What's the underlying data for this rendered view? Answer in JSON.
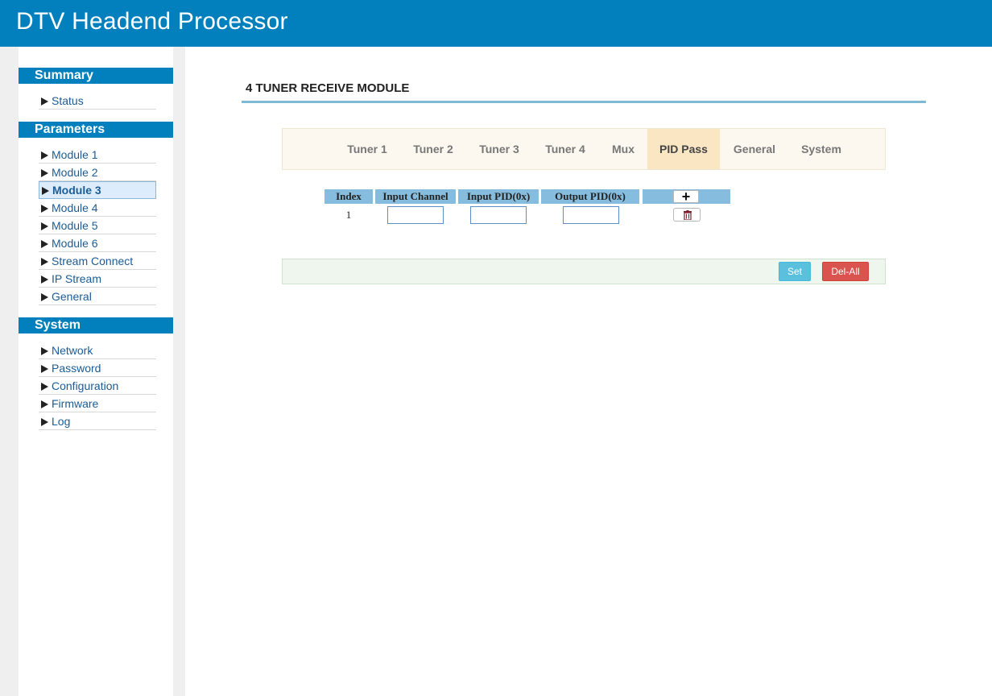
{
  "app": {
    "title": "DTV Headend Processor"
  },
  "sidebar": {
    "summary": {
      "title": "Summary",
      "items": [
        {
          "label": "Status"
        }
      ]
    },
    "parameters": {
      "title": "Parameters",
      "items": [
        {
          "label": "Module 1"
        },
        {
          "label": "Module 2"
        },
        {
          "label": "Module 3",
          "active": true
        },
        {
          "label": "Module 4"
        },
        {
          "label": "Module 5"
        },
        {
          "label": "Module 6"
        },
        {
          "label": "Stream Connect"
        },
        {
          "label": "IP Stream"
        },
        {
          "label": "General"
        }
      ]
    },
    "system": {
      "title": "System",
      "items": [
        {
          "label": "Network"
        },
        {
          "label": "Password"
        },
        {
          "label": "Configuration"
        },
        {
          "label": "Firmware"
        },
        {
          "label": "Log"
        }
      ]
    }
  },
  "main": {
    "page_title": "4 TUNER RECEIVE MODULE",
    "tabs": [
      {
        "label": "Tuner 1"
      },
      {
        "label": "Tuner 2"
      },
      {
        "label": "Tuner 3"
      },
      {
        "label": "Tuner 4"
      },
      {
        "label": "Mux"
      },
      {
        "label": "PID Pass",
        "active": true
      },
      {
        "label": "General"
      },
      {
        "label": "System"
      }
    ],
    "table": {
      "columns": [
        "Index",
        "Input Channel",
        "Input PID(0x)",
        "Output PID(0x)"
      ],
      "add_icon": "plus-icon",
      "rows": [
        {
          "index": "1",
          "input_channel": "",
          "input_pid": "",
          "output_pid": "",
          "delete_icon": "trash-icon"
        }
      ]
    },
    "actions": {
      "set_label": "Set",
      "delete_all_label": "Del-All"
    }
  },
  "colors": {
    "header_bg": "#0180bd",
    "table_header_bg": "#86bcdd",
    "active_tab_bg": "#fae6c3",
    "set_button": "#5bc0de",
    "delete_all_button": "#d9534f"
  }
}
